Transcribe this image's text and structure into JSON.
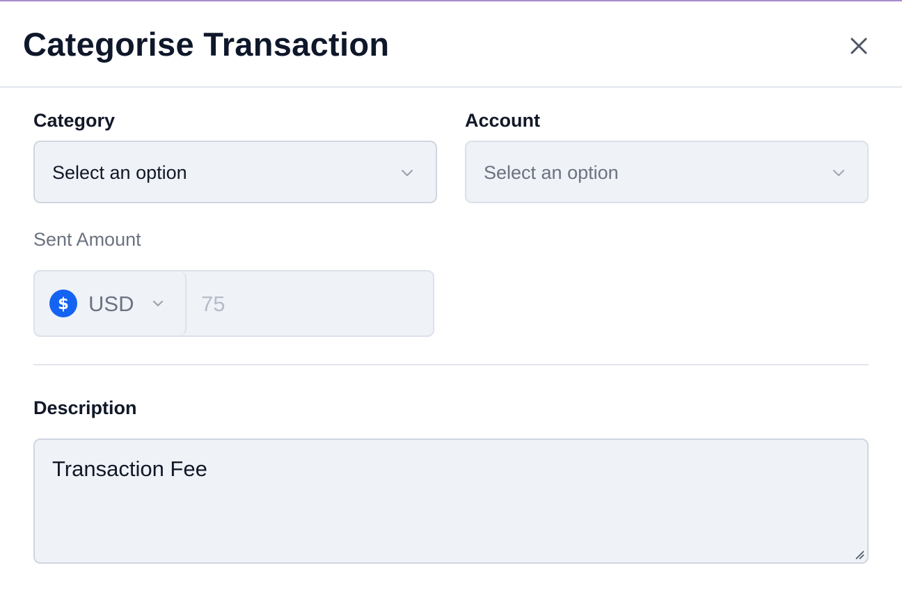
{
  "header": {
    "title": "Categorise Transaction",
    "close_icon": "close-icon"
  },
  "form": {
    "category": {
      "label": "Category",
      "value": "Select an option",
      "icon": "chevron-down-icon"
    },
    "account": {
      "label": "Account",
      "value": "Select an option",
      "icon": "chevron-down-icon"
    },
    "sent_amount": {
      "label": "Sent Amount",
      "currency_icon": "dollar-circle-icon",
      "currency": "USD",
      "amount": "75"
    },
    "description": {
      "label": "Description",
      "value": "Transaction Fee"
    }
  },
  "colors": {
    "accent_bar": "#a78bcd",
    "currency_icon": "#1463f3",
    "field_background": "#eff2f7",
    "field_border": "#cfd6e0"
  }
}
